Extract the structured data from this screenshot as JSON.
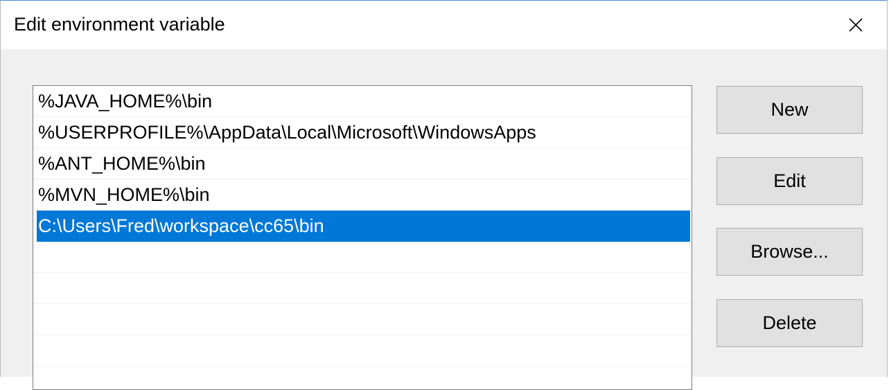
{
  "window": {
    "title": "Edit environment variable"
  },
  "list": {
    "items": [
      {
        "label": "%JAVA_HOME%\\bin",
        "selected": false
      },
      {
        "label": "%USERPROFILE%\\AppData\\Local\\Microsoft\\WindowsApps",
        "selected": false
      },
      {
        "label": "%ANT_HOME%\\bin",
        "selected": false
      },
      {
        "label": "%MVN_HOME%\\bin",
        "selected": false
      },
      {
        "label": "C:\\Users\\Fred\\workspace\\cc65\\bin",
        "selected": true
      }
    ]
  },
  "buttons": {
    "new_label": "New",
    "edit_label": "Edit",
    "browse_label": "Browse...",
    "delete_label": "Delete"
  },
  "icons": {
    "close": "close-icon"
  },
  "colors": {
    "selection": "#0078d7",
    "button_face": "#e1e1e1",
    "dialog_bg": "#f0f0f0"
  }
}
